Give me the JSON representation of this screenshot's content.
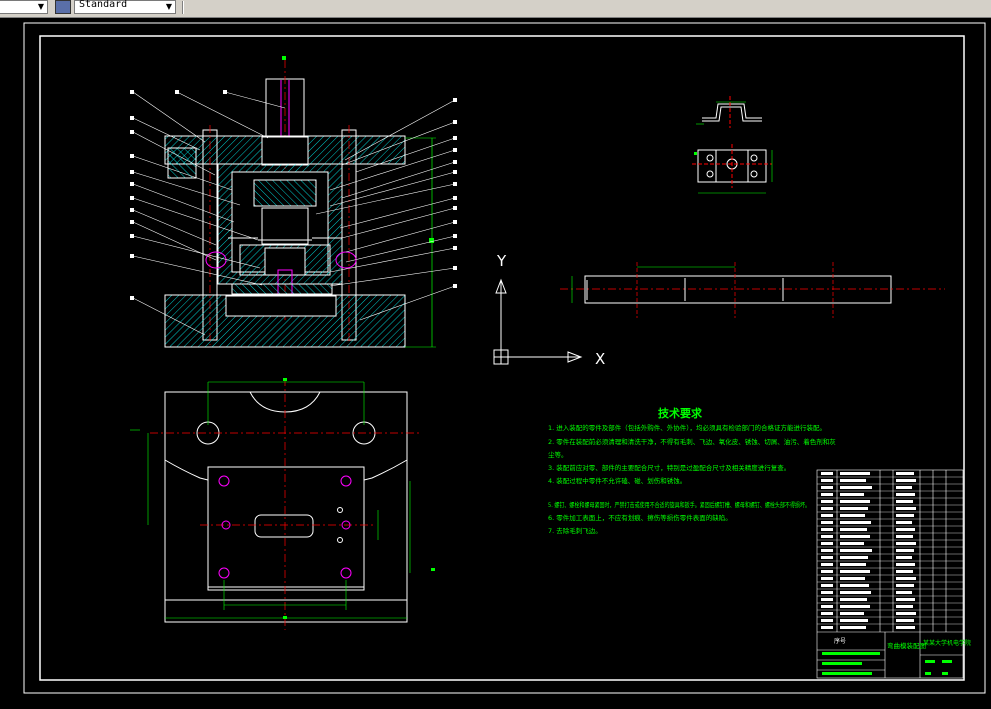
{
  "toolbar": {
    "style_value": "Standard"
  },
  "drawing": {
    "tech_title": "技术要求",
    "notes": [
      "1. 进入装配的零件及部件（包括外购件、外协件），均必须具有检验部门的合格证方能进行装配。",
      "2. 零件在装配前必须清理和清洗干净，不得有毛刺、飞边、氧化皮、锈蚀、切屑、油污、着色剂和灰",
      "尘等。",
      "3. 装配前应对零、部件的主要配合尺寸，特别是过盈配合尺寸及相关精度进行复查。",
      "4. 装配过程中零件不允许磕、碰、划伤和锈蚀。",
      "5. 螺钉、螺栓和螺母紧固时，严禁打击或使用不合适的旋具和扳手。紧固后螺钉槽、螺母和螺钉、螺栓头部不得损坏。",
      "6. 零件加工表面上，不应有划痕、擦伤等损伤零件表面的缺陷。",
      "7. 去除毛刺飞边。"
    ],
    "axis_x": "X",
    "axis_y": "Y",
    "title_block": {
      "drawing_name": "弯曲模装配图",
      "school": "某某大学机电学院",
      "label_no": "序号"
    }
  },
  "colors": {
    "outline": "#ffffff",
    "hatch": "#00ffff",
    "dimension": "#00ff00",
    "center": "#ff0000",
    "part": "#ff00ff"
  }
}
